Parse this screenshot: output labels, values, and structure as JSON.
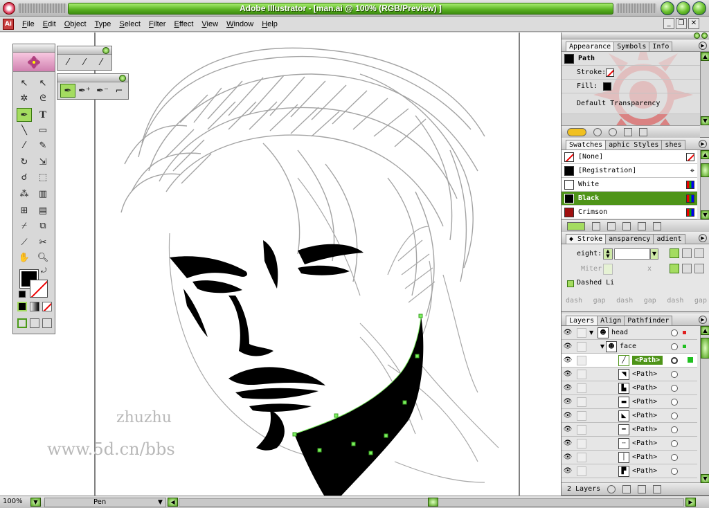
{
  "window": {
    "title": "Adobe Illustrator - [man.ai @ 100% (RGB/Preview) ]"
  },
  "menu": [
    "File",
    "Edit",
    "Object",
    "Type",
    "Select",
    "Filter",
    "Effect",
    "View",
    "Window",
    "Help"
  ],
  "watermark": {
    "line1": "zhuzhu",
    "line2": "www.5d.cn/bbs"
  },
  "appearance": {
    "tabs": [
      "Appearance",
      "Symbols",
      "Info"
    ],
    "object": "Path",
    "stroke_label": "Stroke:",
    "fill_label": "Fill:",
    "transparency": "Default Transparency"
  },
  "swatches": {
    "tabs": [
      "Swatches",
      "aphic Styles",
      "shes"
    ],
    "items": [
      {
        "name": "[None]",
        "color": "#ffffff"
      },
      {
        "name": "[Registration]",
        "color": "#000000"
      },
      {
        "name": "White",
        "color": "#ffffff"
      },
      {
        "name": "Black",
        "color": "#000000"
      },
      {
        "name": "Crimson",
        "color": "#a01010"
      }
    ]
  },
  "stroke": {
    "tabs": [
      "Stroke",
      "ansparency",
      "adient"
    ],
    "weight_label": "eight:",
    "miter_label": "Miter",
    "miter_unit": "x",
    "dashed_label": "Dashed Li",
    "dash_labels": [
      "dash",
      "gap",
      "dash",
      "gap",
      "dash",
      "gap"
    ]
  },
  "layers": {
    "tabs": [
      "Layers",
      "Align",
      "Pathfinder"
    ],
    "rows": [
      {
        "name": "head",
        "indent": 0
      },
      {
        "name": "face",
        "indent": 1
      },
      {
        "name": "<Path>",
        "indent": 2,
        "selected": true
      },
      {
        "name": "<Path>",
        "indent": 2
      },
      {
        "name": "<Path>",
        "indent": 2
      },
      {
        "name": "<Path>",
        "indent": 2
      },
      {
        "name": "<Path>",
        "indent": 2
      },
      {
        "name": "<Path>",
        "indent": 2
      },
      {
        "name": "<Path>",
        "indent": 2
      },
      {
        "name": "<Path>",
        "indent": 2
      },
      {
        "name": "<Path>",
        "indent": 2
      }
    ],
    "count": "2 Layers"
  },
  "status": {
    "zoom": "100%",
    "tool": "Pen"
  },
  "colors": {
    "accent": "#58b020",
    "selected_layer": "#4e9418"
  }
}
